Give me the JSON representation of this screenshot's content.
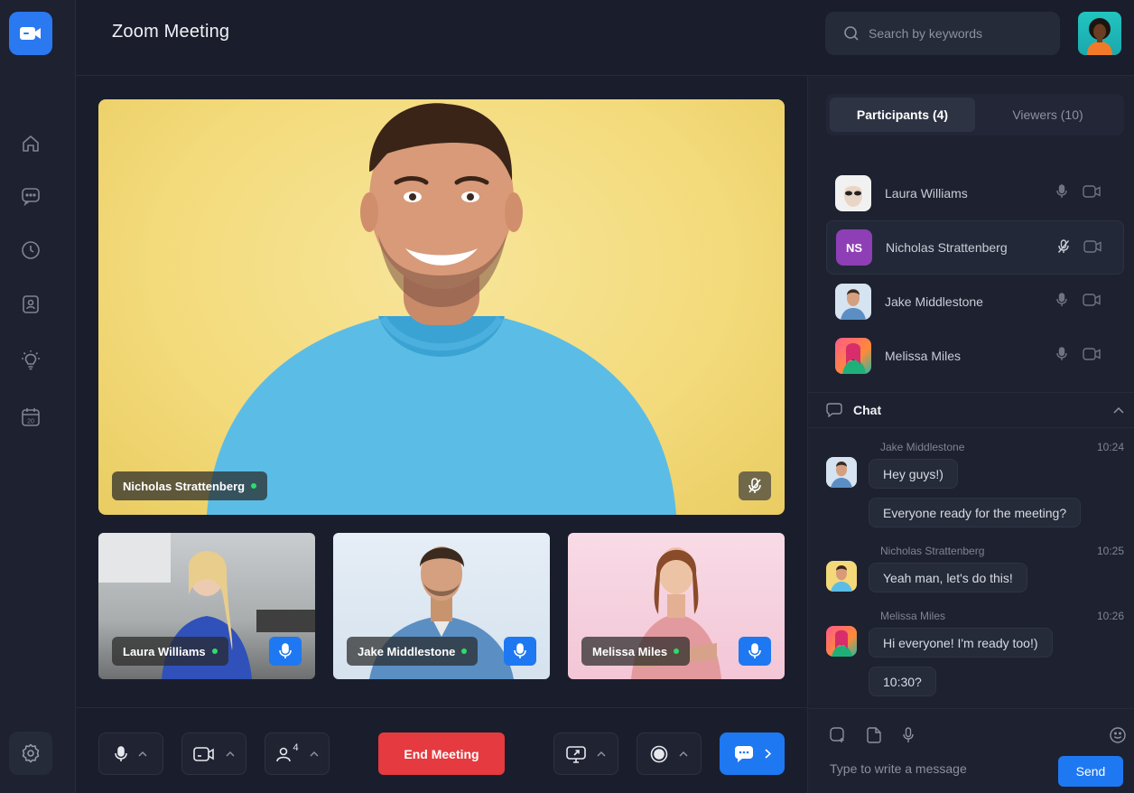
{
  "header": {
    "title": "Zoom Meeting",
    "search_placeholder": "Search by keywords"
  },
  "main_video": {
    "name": "Nicholas Strattenberg"
  },
  "thumbnails": [
    {
      "name": "Laura Williams"
    },
    {
      "name": "Jake Middlestone"
    },
    {
      "name": "Melissa Miles"
    }
  ],
  "toolbar": {
    "end_label": "End Meeting",
    "participants_count": "4"
  },
  "panel": {
    "tabs": [
      "Participants (4)",
      "Viewers (10)"
    ],
    "participants": [
      {
        "name": "Laura Williams",
        "initials": ""
      },
      {
        "name": "Nicholas Strattenberg",
        "initials": "NS"
      },
      {
        "name": "Jake Middlestone",
        "initials": ""
      },
      {
        "name": "Melissa Miles",
        "initials": ""
      }
    ],
    "chat_title": "Chat",
    "messages": [
      {
        "sender": "Jake Middlestone",
        "time": "10:24",
        "texts": [
          "Hey guys!)",
          "Everyone ready for the meeting?"
        ]
      },
      {
        "sender": "Nicholas Strattenberg",
        "time": "10:25",
        "texts": [
          "Yeah man, let's do this!"
        ]
      },
      {
        "sender": "Melissa Miles",
        "time": "10:26",
        "texts": [
          "Hi everyone! I'm ready too!)",
          "10:30?"
        ]
      }
    ],
    "composer_placeholder": "Type to write a message",
    "send_label": "Send"
  },
  "colors": {
    "accent": "#1e78f2",
    "danger": "#e53a3f",
    "online": "#2ddc6b",
    "initials_bg": "#8e3fb5"
  }
}
